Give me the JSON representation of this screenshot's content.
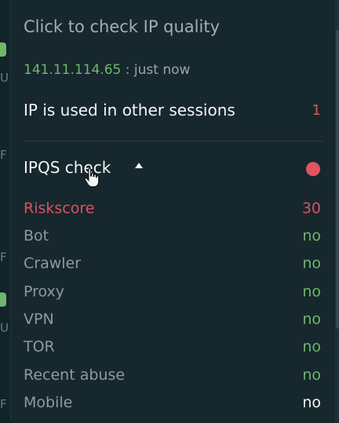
{
  "header": {
    "title": "Click to check IP quality"
  },
  "ip": {
    "address": "141.11.114.65",
    "separator": " : ",
    "checked": "just now"
  },
  "sessions": {
    "label": "IP is used in other sessions",
    "count": "1"
  },
  "ipqs": {
    "title": "IPQS check",
    "status_color": "#e05561",
    "rows": [
      {
        "label": "Riskscore",
        "value": "30"
      },
      {
        "label": "Bot",
        "value": "no"
      },
      {
        "label": "Crawler",
        "value": "no"
      },
      {
        "label": "Proxy",
        "value": "no"
      },
      {
        "label": "VPN",
        "value": "no"
      },
      {
        "label": "TOR",
        "value": "no"
      },
      {
        "label": "Recent abuse",
        "value": "no"
      },
      {
        "label": "Mobile",
        "value": "no"
      }
    ]
  },
  "colors": {
    "accent_green": "#6fb56a",
    "alert_red": "#d9535f",
    "panel_bg": "#17272e"
  },
  "icons": {
    "caret": "caret-up-icon",
    "cursor": "hand-cursor-icon",
    "status": "status-dot-icon"
  }
}
